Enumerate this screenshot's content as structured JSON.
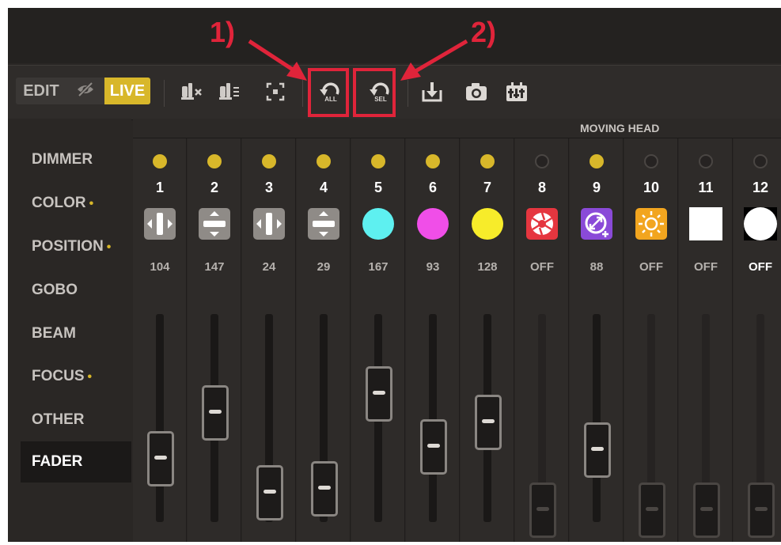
{
  "callouts": [
    {
      "label": "1)"
    },
    {
      "label": "2)"
    }
  ],
  "toolbar": {
    "mode_edit": "EDIT",
    "mode_live": "LIVE",
    "buttons": [
      {
        "icon": "clear-fixtures-icon"
      },
      {
        "icon": "fixtures-list-icon"
      },
      {
        "icon": "select-area-icon"
      },
      {
        "icon": "undo-all-icon",
        "label": "ALL"
      },
      {
        "icon": "undo-selection-icon",
        "label": "SEL"
      },
      {
        "icon": "download-icon"
      },
      {
        "icon": "camera-icon"
      },
      {
        "icon": "mixer-icon"
      }
    ]
  },
  "sidebar": {
    "items": [
      {
        "label": "DIMMER",
        "dot": ""
      },
      {
        "label": "COLOR",
        "dot": "•"
      },
      {
        "label": "POSITION",
        "dot": "•"
      },
      {
        "label": "GOBO",
        "dot": ""
      },
      {
        "label": "BEAM",
        "dot": ""
      },
      {
        "label": "FOCUS",
        "dot": "•"
      },
      {
        "label": "OTHER",
        "dot": ""
      },
      {
        "label": "FADER",
        "dot": "",
        "active": true
      }
    ]
  },
  "group_header": "MOVING HEAD",
  "channels": [
    {
      "num": "1",
      "value": "104",
      "icon": "pan-icon",
      "status": "on"
    },
    {
      "num": "2",
      "value": "147",
      "icon": "tilt-icon",
      "status": "on"
    },
    {
      "num": "3",
      "value": "24",
      "icon": "pan-icon",
      "status": "on"
    },
    {
      "num": "4",
      "value": "29",
      "icon": "tilt-icon",
      "status": "on"
    },
    {
      "num": "5",
      "value": "167",
      "icon": "color-cyan-icon",
      "status": "on",
      "color": "#5ef0f0"
    },
    {
      "num": "6",
      "value": "93",
      "icon": "color-magenta-icon",
      "status": "on",
      "color": "#f04ee8"
    },
    {
      "num": "7",
      "value": "128",
      "icon": "color-yellow-icon",
      "status": "on",
      "color": "#f7ec2a"
    },
    {
      "num": "8",
      "value": "OFF",
      "icon": "shutter-icon",
      "status": "off",
      "color": "#e5363f"
    },
    {
      "num": "9",
      "value": "88",
      "icon": "zoom-icon",
      "status": "on",
      "color": "#8a4ad8"
    },
    {
      "num": "10",
      "value": "OFF",
      "icon": "sun-icon",
      "status": "off",
      "color": "#f2a51f"
    },
    {
      "num": "11",
      "value": "OFF",
      "icon": "white-square-icon",
      "status": "off",
      "color": "#ffffff"
    },
    {
      "num": "12",
      "value": "OFF",
      "icon": "white-circle-icon",
      "status": "off",
      "color": "#ffffff"
    }
  ],
  "fader_levels": [
    0.29,
    0.55,
    0.1,
    0.12,
    0.66,
    0.36,
    0.5,
    0.0,
    0.34,
    0.0,
    0.0,
    0.0
  ],
  "colors": {
    "accent": "#d8b72a",
    "callout": "#e0243a",
    "background": "#2a2725"
  }
}
